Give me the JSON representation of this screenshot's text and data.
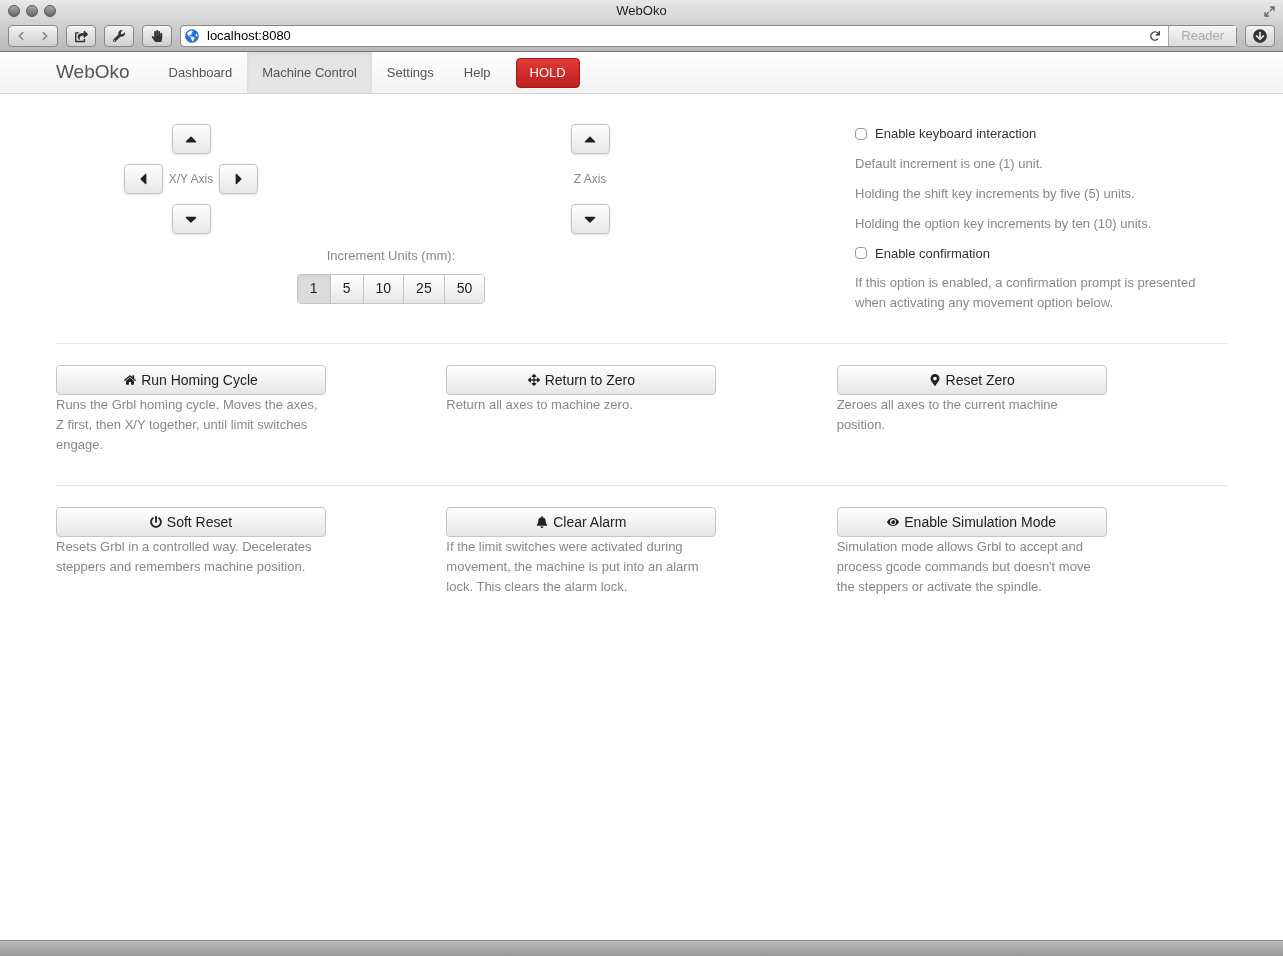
{
  "window": {
    "title": "WebOko"
  },
  "toolbar": {
    "url": "localhost:8080",
    "reader_button": "Reader"
  },
  "nav": {
    "brand": "WebOko",
    "tabs": [
      {
        "label": "Dashboard",
        "selected": false
      },
      {
        "label": "Machine Control",
        "selected": true
      },
      {
        "label": "Settings",
        "selected": false
      },
      {
        "label": "Help",
        "selected": false
      }
    ],
    "hold_button": "HOLD"
  },
  "jog": {
    "xy_label": "X/Y Axis",
    "z_label": "Z Axis",
    "increment_label": "Increment Units (mm):",
    "increments": [
      {
        "label": "1",
        "selected": true
      },
      {
        "label": "5",
        "selected": false
      },
      {
        "label": "10",
        "selected": false
      },
      {
        "label": "25",
        "selected": false
      },
      {
        "label": "50",
        "selected": false
      }
    ]
  },
  "options": [
    {
      "kind": "checkbox",
      "text": "Enable keyboard interaction",
      "checked": false
    },
    {
      "kind": "note",
      "text": "Default increment is one (1) unit."
    },
    {
      "kind": "note",
      "text": "Holding the shift key increments by five (5) units."
    },
    {
      "kind": "note",
      "text": "Holding the option key increments by ten (10) units."
    },
    {
      "kind": "checkbox",
      "text": "Enable confirmation",
      "checked": false
    },
    {
      "kind": "note",
      "text": "If this option is enabled, a confirmation prompt is presented when activating any movement option below."
    }
  ],
  "action_rows": [
    [
      {
        "label": "Run Homing Cycle",
        "description": "Runs the Grbl homing cycle. Moves the axes, Z first, then X/Y together, until limit switches engage."
      },
      {
        "label": "Return to Zero",
        "description": "Return all axes to machine zero."
      },
      {
        "label": "Reset Zero",
        "description": "Zeroes all axes to the current machine position."
      }
    ],
    [
      {
        "label": "Soft Reset",
        "description": "Resets Grbl in a controlled way. Decelerates steppers and remembers machine position."
      },
      {
        "label": "Clear Alarm",
        "description": "If the limit switches were activated during movement, the machine is put into an alarm lock. This clears the alarm lock."
      },
      {
        "label": "Enable Simulation Mode",
        "description": "Simulation mode allows Grbl to accept and process gcode commands but doesn't move the steppers or activate the spindle."
      }
    ]
  ]
}
